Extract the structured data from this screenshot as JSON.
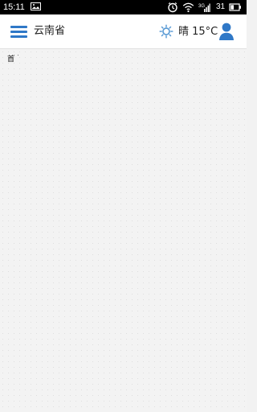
{
  "status_bar": {
    "time": "15:11",
    "battery_level": "31"
  },
  "header": {
    "location": "云南省",
    "weather": "晴 15°C"
  },
  "content": {
    "small_label": "首"
  },
  "colors": {
    "accent": "#2f78c7",
    "weather_icon": "#5b9bd5",
    "background": "#f3f3f3"
  },
  "icons": {
    "menu": "hamburger-menu-icon",
    "weather": "sun-icon",
    "profile": "user-profile-icon",
    "status_image": "image-icon",
    "alarm": "alarm-clock-icon",
    "wifi": "wifi-icon",
    "signal": "signal-icon",
    "battery": "battery-icon"
  }
}
